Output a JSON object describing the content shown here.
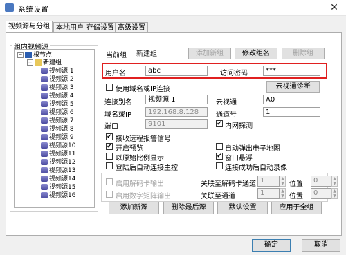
{
  "window": {
    "title": "系统设置",
    "close_symbol": "✕"
  },
  "tabs": [
    {
      "label": "视频源与分组"
    },
    {
      "label": "本地用户"
    },
    {
      "label": "存储设置"
    },
    {
      "label": "高级设置"
    }
  ],
  "tree": {
    "group_label": "组内视频源",
    "root": "根节点",
    "group": "新建组",
    "items": [
      "视频源 1",
      "视频源 2",
      "视频源 3",
      "视频源 4",
      "视频源 5",
      "视频源 6",
      "视频源 7",
      "视频源 8",
      "视频源 9",
      "视频源10",
      "视频源11",
      "视频源12",
      "视频源13",
      "视频源14",
      "视频源15",
      "视频源16"
    ]
  },
  "current_group": {
    "label": "当前组",
    "value": "新建组",
    "add_label": "添加新组",
    "rename_label": "修改组名",
    "delete_label": "删除组"
  },
  "auth": {
    "user_label": "用户名",
    "user_value": "abc",
    "password_label": "访问密码",
    "password_value": "***"
  },
  "connection": {
    "use_domain_label": "使用域名或IP连接",
    "diag_label": "云视通诊断",
    "alias_label": "连接别名",
    "alias_value": "视频源 1",
    "cloud_label": "云视通",
    "cloud_value": "A0",
    "domain_label": "域名或IP",
    "domain_value": "192.168.8.128",
    "channel_label": "通道号",
    "channel_value": "1",
    "port_label": "端口",
    "port_value": "9101",
    "lan_label": "内网探测"
  },
  "options": {
    "alarm": "接收远程报警信号",
    "preview": "开启预览",
    "auto_map": "自动弹出电子地图",
    "ratio": "以原始比例显示",
    "float_window": "窗口悬浮",
    "auto_master": "登陆后自动连接主控",
    "auto_record": "连接成功后自动录像"
  },
  "decoder": {
    "label": "启用解码卡输出",
    "assoc_label": "关联至解码卡通道",
    "value": "1",
    "pos_label": "位置",
    "pos_value": "0"
  },
  "matrix": {
    "label": "启用数字矩阵输出",
    "assoc_label": "关联至通道",
    "value": "1",
    "pos_label": "位置",
    "pos_value": "0"
  },
  "actions": {
    "add_source": "添加新源",
    "delete_last": "删除最后源",
    "default": "默认设置",
    "apply_all": "应用于全组"
  },
  "footer": {
    "ok": "确定",
    "cancel": "取消"
  }
}
